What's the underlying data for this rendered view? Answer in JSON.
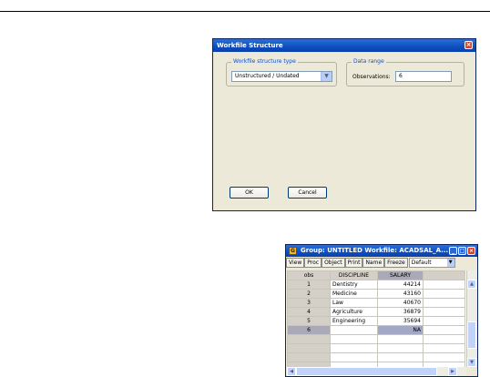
{
  "dialog": {
    "title": "Workfile Structure",
    "structure_type_legend": "Workfile structure type",
    "structure_type_value": "Unstructured / Undated",
    "data_range_legend": "Data range",
    "observations_label": "Observations:",
    "observations_value": "6",
    "ok_label": "OK",
    "cancel_label": "Cancel"
  },
  "group_window": {
    "title": "Group: UNTITLED   Workfile: ACADSAL_A...",
    "toolbar": [
      "View",
      "Proc",
      "Object",
      "Print",
      "Name",
      "Freeze"
    ],
    "display_select": "Default",
    "columns": [
      "obs",
      "DISCIPLINE",
      "SALARY"
    ],
    "rows": [
      {
        "obs": "1",
        "discipline": "Dentistry",
        "salary": "44214"
      },
      {
        "obs": "2",
        "discipline": "Medicine",
        "salary": "43160"
      },
      {
        "obs": "3",
        "discipline": "Law",
        "salary": "40670"
      },
      {
        "obs": "4",
        "discipline": "Agriculture",
        "salary": "36879"
      },
      {
        "obs": "5",
        "discipline": "Engineering",
        "salary": "35694"
      },
      {
        "obs": "6",
        "discipline": "",
        "salary": "NA"
      }
    ]
  }
}
